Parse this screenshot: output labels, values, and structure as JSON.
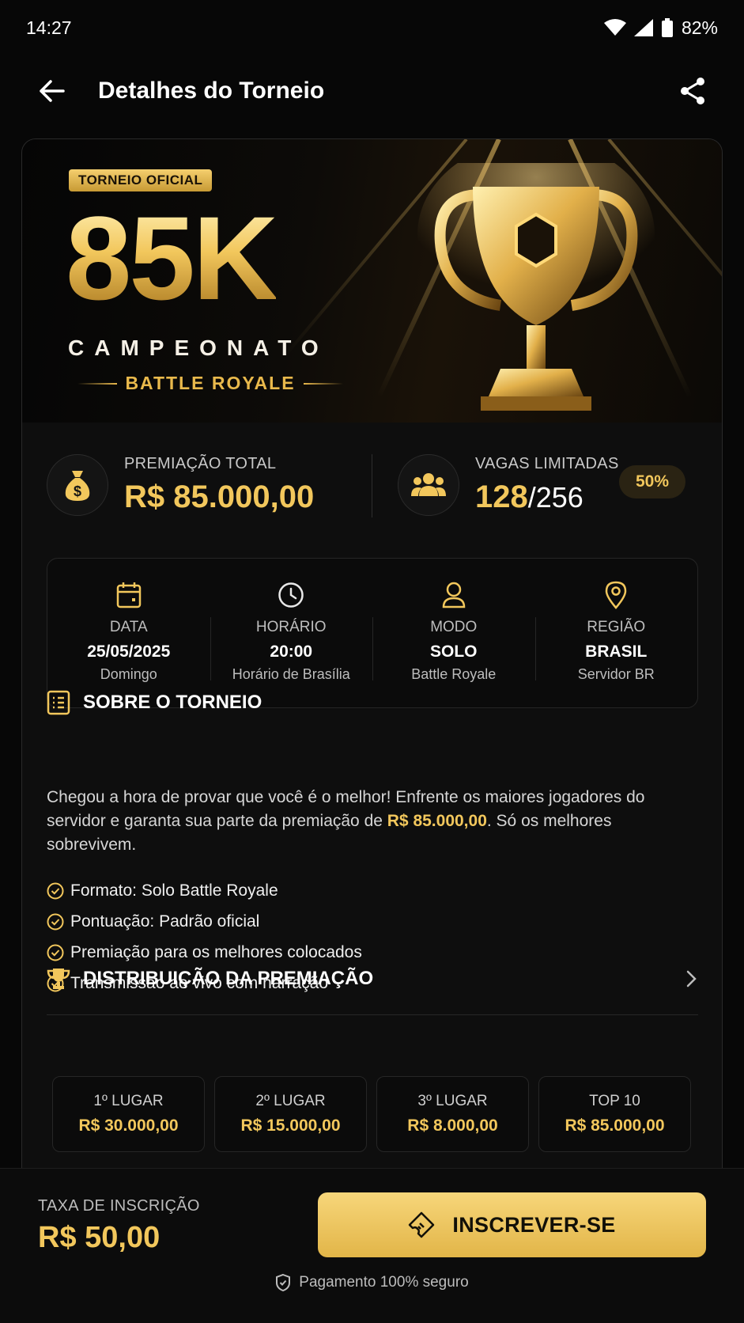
{
  "status_bar": {
    "time": "14:27",
    "battery": "82%"
  },
  "app_bar": {
    "title": "Detalhes do Torneio"
  },
  "banner": {
    "badge": "TORNEIO OFICIAL",
    "headline": "85K",
    "subtitle": "CAMPEONATO",
    "mode": "BATTLE ROYALE"
  },
  "stats": {
    "prize": {
      "label": "PREMIAÇÃO TOTAL",
      "value": "R$ 85.000,00"
    },
    "slots": {
      "label": "VAGAS LIMITADAS",
      "filled": "128",
      "total": "/256",
      "percent_label": "50%",
      "percent": 50
    }
  },
  "info": [
    {
      "label": "DATA",
      "value": "25/05/2025",
      "sub": "Domingo",
      "icon": "calendar-icon"
    },
    {
      "label": "HORÁRIO",
      "value": "20:00",
      "sub": "Horário de Brasília",
      "icon": "clock-icon"
    },
    {
      "label": "MODO",
      "value": "SOLO",
      "sub": "Battle Royale",
      "icon": "user-icon"
    },
    {
      "label": "REGIÃO",
      "value": "BRASIL",
      "sub": "Servidor BR",
      "icon": "location-pin-icon"
    }
  ],
  "about": {
    "title": "SOBRE O TORNEIO",
    "text_before": "Chegou a hora de provar que você é o melhor! Enfrente os maiores jogadores do servidor e garanta sua parte da premiação de ",
    "text_highlight": "R$ 85.000,00",
    "text_after": ". Só os melhores sobrevivem.",
    "items": [
      "Formato: Solo Battle Royale",
      "Pontuação: Padrão oficial",
      "Premiação para os melhores colocados",
      "Transmissão ao vivo com narração"
    ]
  },
  "distribution": {
    "title": "DISTRIBUIÇÃO DA PREMIAÇÃO",
    "places": [
      {
        "label": "1º LUGAR",
        "value": "R$ 30.000,00"
      },
      {
        "label": "2º LUGAR",
        "value": "R$ 15.000,00"
      },
      {
        "label": "3º LUGAR",
        "value": "R$ 8.000,00"
      },
      {
        "label": "TOP 10",
        "value": "R$ 85.000,00"
      }
    ]
  },
  "footer": {
    "fee_label": "TAXA DE INSCRIÇÃO",
    "fee_value": "R$ 50,00",
    "cta_label": "INSCREVER-SE",
    "secure_text": "Pagamento 100% seguro"
  },
  "colors": {
    "accent": "#f2c75c",
    "background": "#070707",
    "card": "#0e0e0e"
  }
}
